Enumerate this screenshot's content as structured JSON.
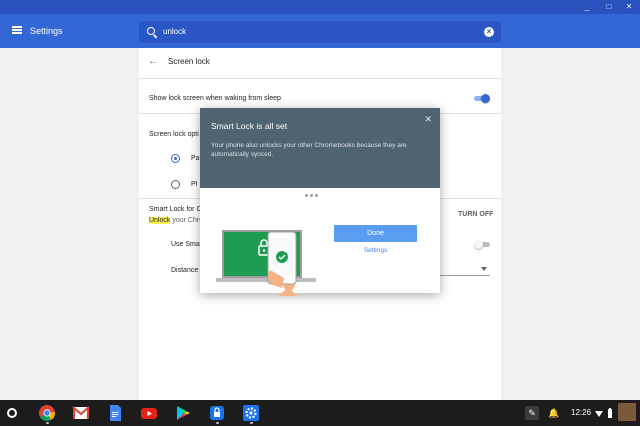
{
  "window": {
    "controls": [
      "_",
      "□",
      "✕"
    ]
  },
  "header": {
    "title": "Settings"
  },
  "search": {
    "value": "unlock"
  },
  "screen_lock": {
    "title": "Screen lock",
    "show_lock_label": "Show lock screen when waking from sleep",
    "show_lock_on": true,
    "options_label": "Screen lock opti",
    "option_password": "Pa",
    "option_pin": "PI",
    "smart_lock_label": "Smart Lock for C",
    "unlock_highlight": "Unlock",
    "unlock_rest": " your Chrom",
    "turn_off": "TURN OFF",
    "use_smart_label": "Use Smar",
    "use_smart_on": false,
    "distance_label": "Distance"
  },
  "dialog": {
    "title": "Smart Lock is all set",
    "close": "✕",
    "body": "Your phone also unlocks your other Chromebooks because they are automatically synced.",
    "done_button": "Done",
    "settings_link": "Settings"
  },
  "shelf": {
    "apps": [
      "chrome-icon",
      "gmail-icon",
      "docs-icon",
      "youtube-icon",
      "play-store-icon",
      "smart-lock-icon",
      "settings-icon"
    ],
    "time": "12:26"
  },
  "colors": {
    "accent": "#3367d6",
    "dialog_header": "#4e6470",
    "done_button": "#5c9cf0",
    "highlight": "#fdf34f"
  }
}
